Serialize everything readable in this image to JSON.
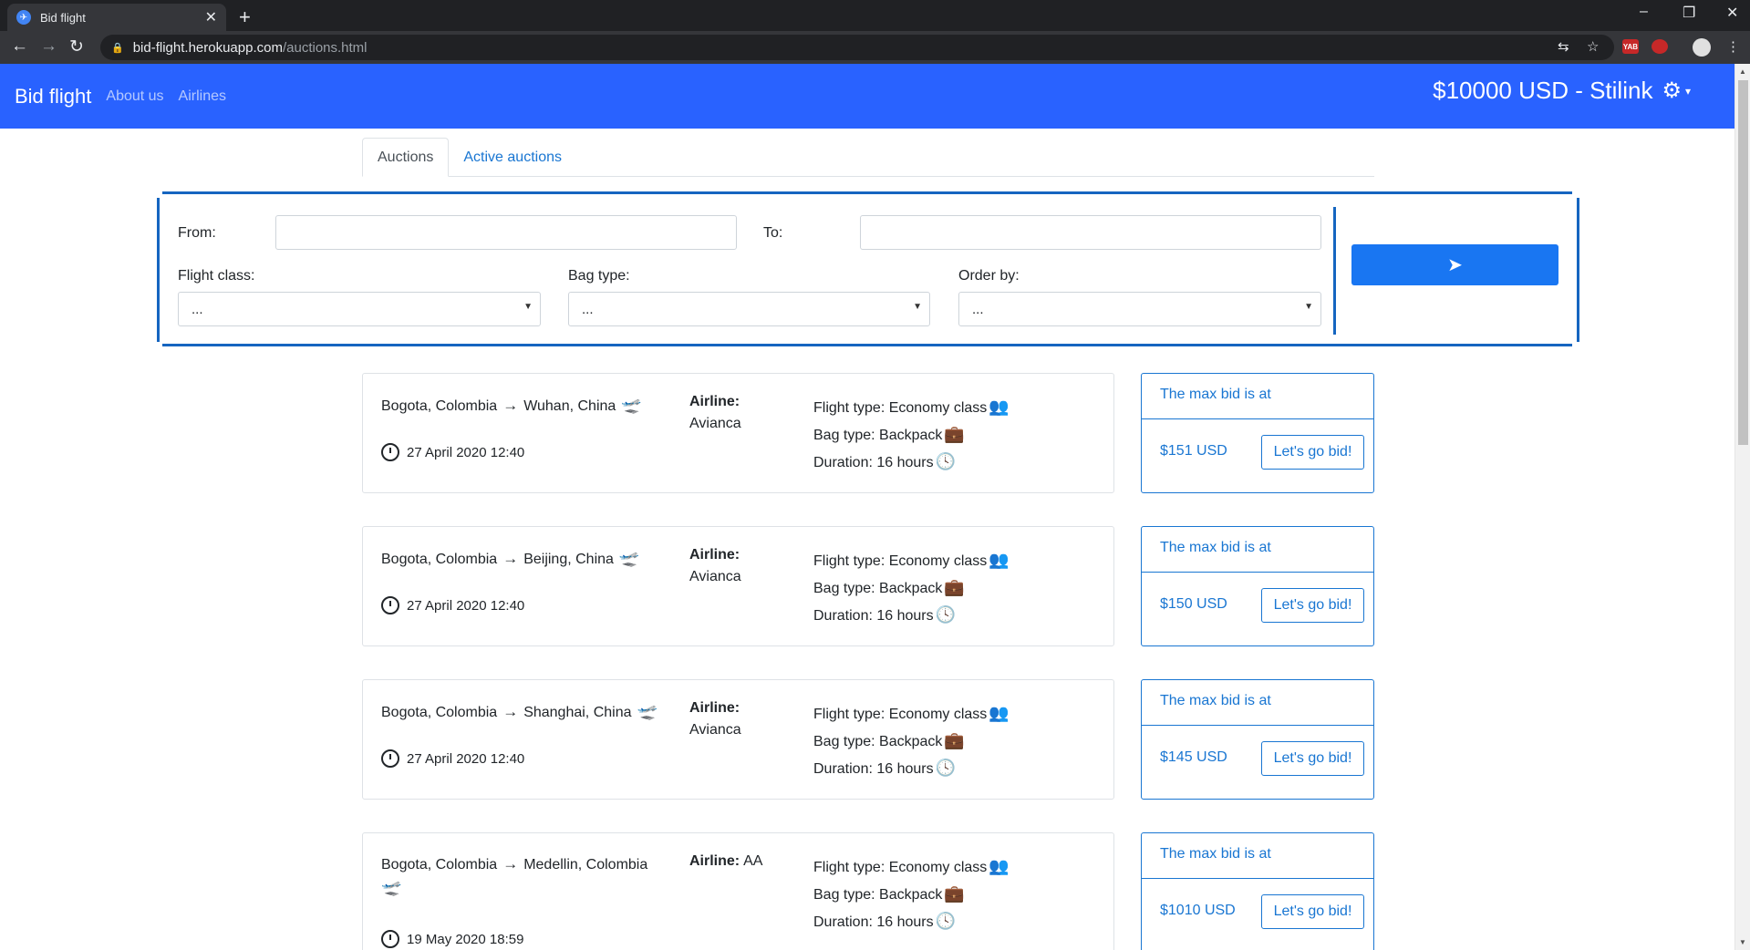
{
  "browser": {
    "tab_title": "Bid flight",
    "url_host": "bid-flight.herokuapp.com",
    "url_path": "/auctions.html",
    "ext_label": "YAB"
  },
  "navbar": {
    "brand": "Bid flight",
    "links": [
      "About us",
      "Airlines"
    ],
    "balance": "$10000 USD - Stilink",
    "color": "#2962ff"
  },
  "tabs": [
    "Auctions",
    "Active auctions"
  ],
  "search": {
    "from_label": "From:",
    "to_label": "To:",
    "from_value": "",
    "to_value": "",
    "flight_class_label": "Flight class:",
    "bag_type_label": "Bag type:",
    "order_by_label": "Order by:",
    "flight_class_value": "...",
    "bag_type_value": "...",
    "order_by_value": "...",
    "go_icon": "paper-plane-icon"
  },
  "flights": [
    {
      "from": "Bogota, Colombia",
      "to": "Wuhan, China",
      "date": "27 April 2020 12:40",
      "airline_label": "Airline:",
      "airline": "Avianca",
      "flight_type": "Flight type: Economy class",
      "bag_type": "Bag type: Backpack",
      "duration": "Duration: 16 hours",
      "bid_head": "The max bid is at",
      "bid_amount": "$151 USD",
      "bid_button": "Let's go bid!"
    },
    {
      "from": "Bogota, Colombia",
      "to": "Beijing, China",
      "date": "27 April 2020 12:40",
      "airline_label": "Airline:",
      "airline": "Avianca",
      "flight_type": "Flight type: Economy class",
      "bag_type": "Bag type: Backpack",
      "duration": "Duration: 16 hours",
      "bid_head": "The max bid is at",
      "bid_amount": "$150 USD",
      "bid_button": "Let's go bid!"
    },
    {
      "from": "Bogota, Colombia",
      "to": "Shanghai, China",
      "date": "27 April 2020 12:40",
      "airline_label": "Airline:",
      "airline": "Avianca",
      "flight_type": "Flight type: Economy class",
      "bag_type": "Bag type: Backpack",
      "duration": "Duration: 16 hours",
      "bid_head": "The max bid is at",
      "bid_amount": "$145 USD",
      "bid_button": "Let's go bid!"
    },
    {
      "from": "Bogota, Colombia",
      "to": "Medellin, Colombia",
      "date": "19 May 2020 18:59",
      "airline_label": "Airline:",
      "airline": "AA",
      "flight_type": "Flight type: Economy class",
      "bag_type": "Bag type: Backpack",
      "duration": "Duration: 16 hours",
      "bid_head": "The max bid is at",
      "bid_amount": "$1010 USD",
      "bid_button": "Let's go bid!"
    }
  ]
}
